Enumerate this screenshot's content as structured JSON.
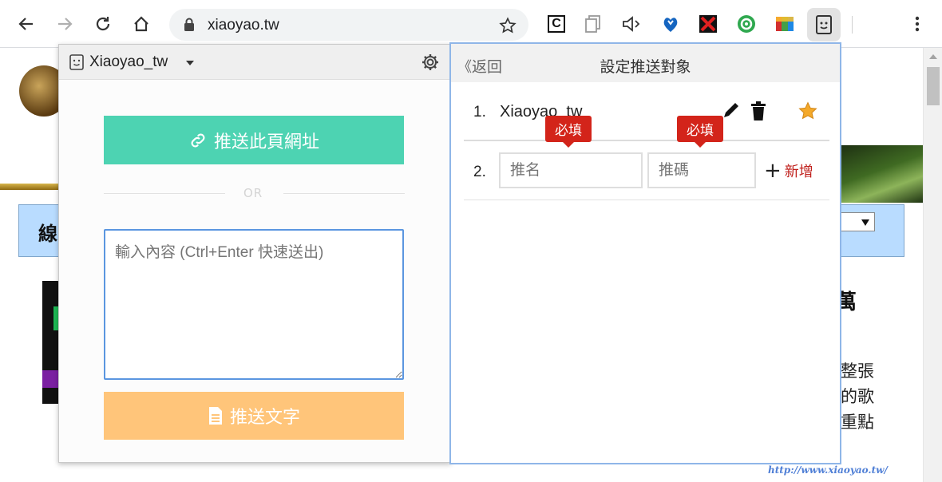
{
  "browser": {
    "url": "xiaoyao.tw",
    "icons": {
      "back": "arrow-left-icon",
      "forward": "arrow-right-icon",
      "reload": "reload-icon",
      "home": "home-icon",
      "lock": "lock-icon",
      "bookmark": "star-outline-icon",
      "menu": "kebab-menu-icon"
    },
    "extensions": [
      "c-extension-icon",
      "copy-pages-icon",
      "speaker-icon",
      "heart-shield-icon",
      "x-cross-icon",
      "gear-badge-icon",
      "color-blocks-icon",
      "pushbullet-face-icon"
    ]
  },
  "background_page": {
    "nav_label": "線",
    "heading_char": "萬",
    "paragraph_lines": [
      "整張",
      "的歌",
      "重點"
    ],
    "watermark_url": "http://www.xiaoyao.tw/"
  },
  "popup": {
    "account_name": "Xiaoyao_tw",
    "push_url_label": "推送此頁網址",
    "or_label": "OR",
    "input_placeholder": "輸入內容 (Ctrl+Enter 快速送出)",
    "push_text_label": "推送文字"
  },
  "target_panel": {
    "back_label": "返回",
    "title": "設定推送對象",
    "rows": [
      {
        "index": "1.",
        "name": "Xiaoyao_tw"
      },
      {
        "index": "2.",
        "name_placeholder": "推名",
        "code_placeholder": "推碼"
      }
    ],
    "required_tip": "必填",
    "add_label": "新增",
    "colors": {
      "accent_red": "#d3241a",
      "star": "#f4a92a"
    }
  }
}
